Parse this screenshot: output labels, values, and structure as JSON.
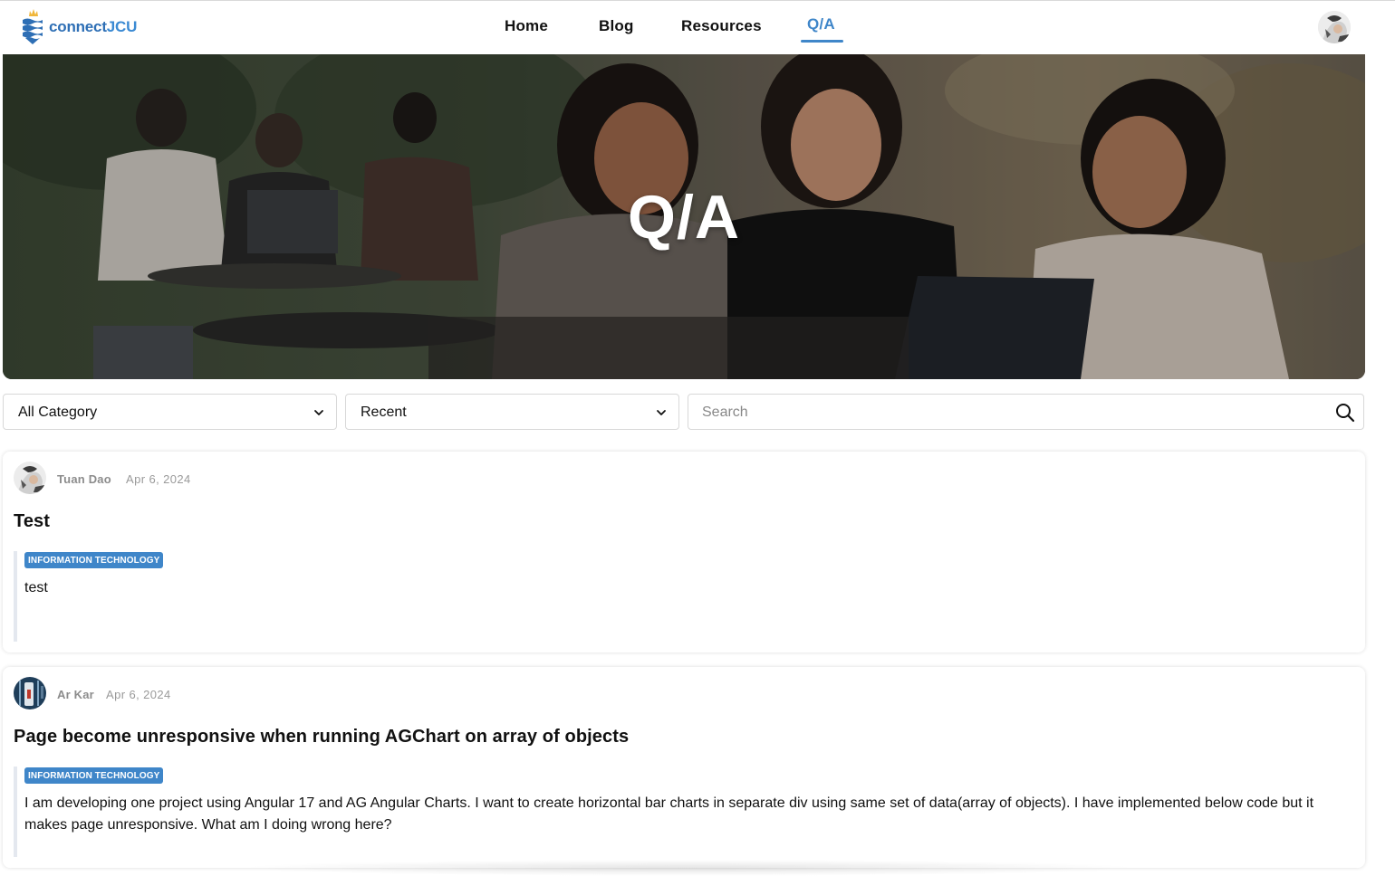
{
  "app": {
    "logo_main": "connect",
    "logo_accent": "JCU"
  },
  "nav": {
    "items": [
      {
        "label": "Home"
      },
      {
        "label": "Blog"
      },
      {
        "label": "Resources"
      },
      {
        "label": "Q/A",
        "active": true
      }
    ]
  },
  "hero": {
    "title": "Q/A"
  },
  "filters": {
    "category_selected": "All Category",
    "sort_selected": "Recent",
    "search_placeholder": "Search"
  },
  "posts": [
    {
      "author": "Tuan Dao",
      "date": "Apr 6, 2024",
      "title": "Test",
      "category": "INFORMATION TECHNOLOGY",
      "body": "test"
    },
    {
      "author": "Ar Kar",
      "date": "Apr 6, 2024",
      "title": "Page become unresponsive when running AGChart on array of objects",
      "category": "INFORMATION TECHNOLOGY",
      "body": "I am developing one project using Angular 17 and AG Angular Charts. I want to create horizontal bar charts in separate div using same set of data(array of objects). I have implemented below code but it makes page unresponsive. What am I doing wrong here?"
    }
  ],
  "colors": {
    "accent": "#3f86c9",
    "logo_blue": "#2e6fb5",
    "text": "#111111",
    "muted": "#8c8c8c"
  }
}
